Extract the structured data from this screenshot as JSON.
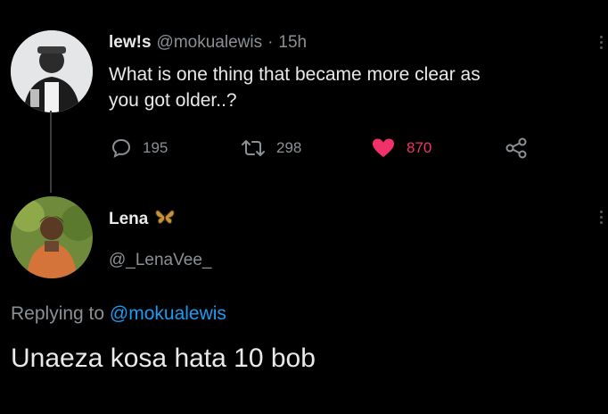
{
  "tweet": {
    "display_name": "lew!s",
    "handle": "@mokualewis",
    "separator": "·",
    "time": "15h",
    "text_line1": "What is one thing that became more clear as",
    "text_line2": "you got older..?",
    "avatar_icon": "user-avatar-icon",
    "actions": {
      "reply_count": "195",
      "retweet_count": "298",
      "like_count": "870",
      "reply_icon": "comment-icon",
      "retweet_icon": "retweet-icon",
      "like_icon": "heart-icon",
      "share_icon": "share-icon"
    }
  },
  "reply": {
    "display_name": "Lena",
    "name_emoji": "butterfly-icon",
    "handle": "@_LenaVee_",
    "replying_prefix": "Replying to",
    "replying_handle": "@mokualewis",
    "text": "Unaeza kosa hata 10 bob",
    "avatar_icon": "user-avatar-icon"
  },
  "colors": {
    "background": "#000000",
    "text": "#e7e9ea",
    "muted": "#8b9095",
    "like": "#f0316a",
    "mention": "#1d9bf0"
  }
}
